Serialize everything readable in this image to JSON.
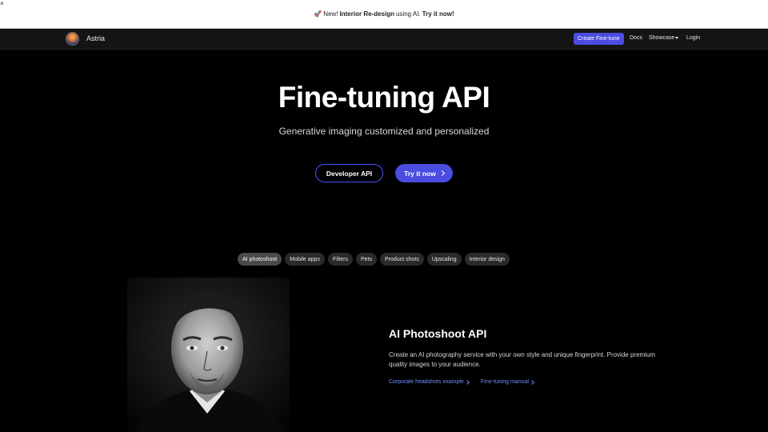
{
  "banner": {
    "new": "New!",
    "product": "Interior Re-design",
    "middle": "using AI.",
    "cta": "Try it now!",
    "close": "×"
  },
  "nav": {
    "brand": "Astria",
    "create": "Create Fine-tune",
    "docs": "Docs",
    "showcase": "Showcase",
    "login": "Login"
  },
  "hero": {
    "title": "Fine-tuning API",
    "subtitle": "Generative imaging customized and personalized",
    "developer_btn": "Developer API",
    "try_btn": "Try it now"
  },
  "tabs": [
    "AI photoshoot",
    "Mobile apps",
    "Filters",
    "Pets",
    "Product shots",
    "Upscaling",
    "Interior design"
  ],
  "feature": {
    "title": "AI Photoshoot API",
    "description": "Create an AI photography service with your own style and unique fingerprint. Provide premium quality images to your audience.",
    "link1": "Corporate headshots example",
    "link2": "Fine-tuning manual"
  },
  "colors": {
    "accent": "#4a4de0",
    "link": "#6f8dff",
    "background": "#000000"
  }
}
